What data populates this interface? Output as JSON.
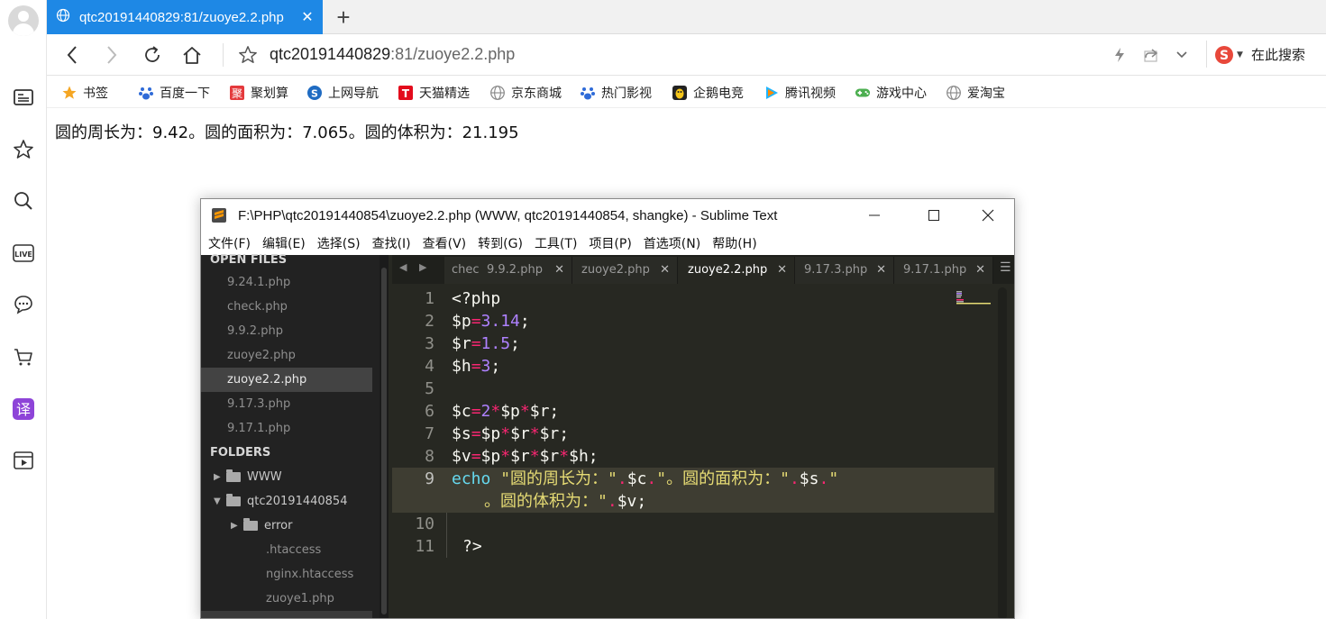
{
  "browser": {
    "tab_title": "qtc20191440829:81/zuoye2.2.php",
    "tab_close": "✕",
    "new_tab": "+",
    "url_host": "qtc20191440829",
    "url_rest": ":81/zuoye2.2.php",
    "search_label": "在此搜索"
  },
  "bookmarks": [
    {
      "label": "书签",
      "icon": "star-icon",
      "color": "#f5a623"
    },
    {
      "label": "百度一下",
      "icon": "baidu-icon",
      "color": "#2f6bd8"
    },
    {
      "label": "聚划算",
      "icon": "juhuasuan-icon",
      "color": "#e4393c"
    },
    {
      "label": "上网导航",
      "icon": "sogou-nav-icon",
      "color": "#1f6bc2"
    },
    {
      "label": "天猫精选",
      "icon": "tmall-icon",
      "color": "#e30b1c"
    },
    {
      "label": "京东商城",
      "icon": "globe-icon",
      "color": "#888888"
    },
    {
      "label": "热门影视",
      "icon": "paw-icon",
      "color": "#2f6bd8"
    },
    {
      "label": "企鹅电竞",
      "icon": "penguin-icon",
      "color": "#222222"
    },
    {
      "label": "腾讯视频",
      "icon": "tencent-video-icon",
      "color": "#1fb5ff"
    },
    {
      "label": "游戏中心",
      "icon": "gamepad-icon",
      "color": "#4caf50"
    },
    {
      "label": "爱淘宝",
      "icon": "globe-icon",
      "color": "#888888"
    }
  ],
  "page": {
    "output": "圆的周长为：9.42。圆的面积为：7.065。圆的体积为：21.195"
  },
  "sublime": {
    "title": "F:\\PHP\\qtc20191440854\\zuoye2.2.php (WWW, qtc20191440854, shangke) - Sublime Text",
    "menus": [
      "文件(F)",
      "编辑(E)",
      "选择(S)",
      "查找(I)",
      "查看(V)",
      "转到(G)",
      "工具(T)",
      "项目(P)",
      "首选项(N)",
      "帮助(H)"
    ],
    "open_files_label": "OPEN FILES",
    "open_files": [
      "9.24.1.php",
      "check.php",
      "9.9.2.php",
      "zuoye2.php",
      "zuoye2.2.php",
      "9.17.3.php",
      "9.17.1.php"
    ],
    "active_file": "zuoye2.2.php",
    "folders_label": "FOLDERS",
    "folders": [
      "WWW",
      "qtc20191440854",
      "error"
    ],
    "folder_files": [
      ".htaccess",
      "nginx.htaccess",
      "zuoye1.php"
    ],
    "tabs": [
      {
        "label": "chec",
        "close": ""
      },
      {
        "label": "9.9.2.php",
        "close": "✕"
      },
      {
        "label": "zuoye2.php",
        "close": "✕"
      },
      {
        "label": "zuoye2.2.php",
        "close": "✕"
      },
      {
        "label": "9.17.3.php",
        "close": "✕"
      },
      {
        "label": "9.17.1.php",
        "close": "✕"
      }
    ],
    "line_numbers": [
      "1",
      "2",
      "3",
      "4",
      "5",
      "6",
      "7",
      "8",
      "9",
      "10",
      "11"
    ],
    "code": {
      "l1": "<?php",
      "l2_var": "$p",
      "l2_op": "=",
      "l2_num": "3.14",
      "l2_end": ";",
      "l3_var": "$r",
      "l3_op": "=",
      "l3_num": "1.5",
      "l3_end": ";",
      "l4_var": "$h",
      "l4_op": "=",
      "l4_num": "3",
      "l4_end": ";",
      "l6_a": "$c",
      "l6_eq": "=",
      "l6_num": "2",
      "l6_m1": "*",
      "l6_b": "$p",
      "l6_m2": "*",
      "l6_c": "$r;",
      "l7_a": "$s",
      "l7_eq": "=",
      "l7_b": "$p",
      "l7_m1": "*",
      "l7_c": "$r",
      "l7_m2": "*",
      "l7_d": "$r;",
      "l8_a": "$v",
      "l8_eq": "=",
      "l8_b": "$p",
      "l8_m1": "*",
      "l8_c": "$r",
      "l8_m2": "*",
      "l8_d": "$r",
      "l8_m3": "*",
      "l8_e": "$h;",
      "l9_kw": "echo",
      "l9_s1": "\"圆的周长为：\"",
      "l9_d1": ".",
      "l9_v1": "$c",
      "l9_d2": ".",
      "l9_s2": "\"。圆的面积为：\"",
      "l9_d3": ".",
      "l9_v2": "$s",
      "l9_d4": ".",
      "l9_s3": "\"",
      "l9b_s": "。圆的体积为：\"",
      "l9b_d": ".",
      "l9b_v": "$v;",
      "l11": "?>"
    }
  }
}
